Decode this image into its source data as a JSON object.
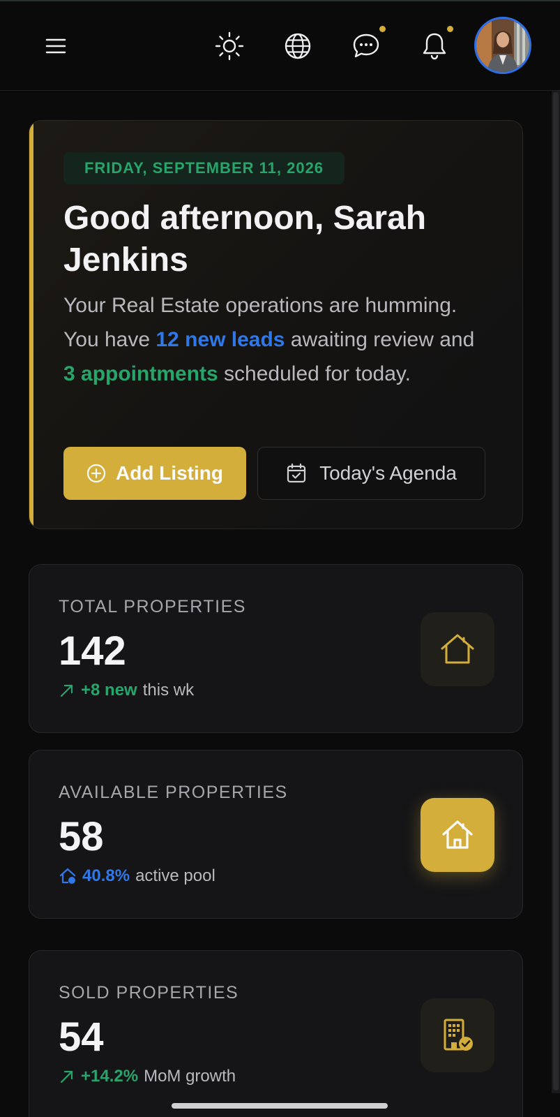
{
  "header": {
    "icons": [
      "menu-icon",
      "sun-icon",
      "globe-icon",
      "chat-icon",
      "bell-icon"
    ],
    "accent": "#d4ae3a"
  },
  "hero": {
    "date": "FRIDAY, SEPTEMBER 11, 2026",
    "greeting": "Good afternoon, Sarah Jenkins",
    "summary_prefix": "Your Real Estate operations are humming. You have ",
    "leads": "12 new leads",
    "summary_mid": " awaiting review and ",
    "appointments": "3 appointments",
    "summary_suffix": " scheduled for today.",
    "primary_button": "Add Listing",
    "secondary_button": "Today's Agenda"
  },
  "stats": [
    {
      "label": "TOTAL PROPERTIES",
      "value": "142",
      "delta": "+8 new",
      "suffix": "this wk",
      "icon": "house-icon"
    },
    {
      "label": "AVAILABLE PROPERTIES",
      "value": "58",
      "delta": "40.8%",
      "suffix": "active pool",
      "icon": "house-icon"
    },
    {
      "label": "SOLD PROPERTIES",
      "value": "54",
      "delta": "+14.2%",
      "suffix": "MoM growth",
      "icon": "building-check-icon"
    }
  ],
  "colors": {
    "gold": "#d4ae3a",
    "green": "#27a56a",
    "blue": "#2f78ea",
    "background": "#0b0b0c"
  }
}
